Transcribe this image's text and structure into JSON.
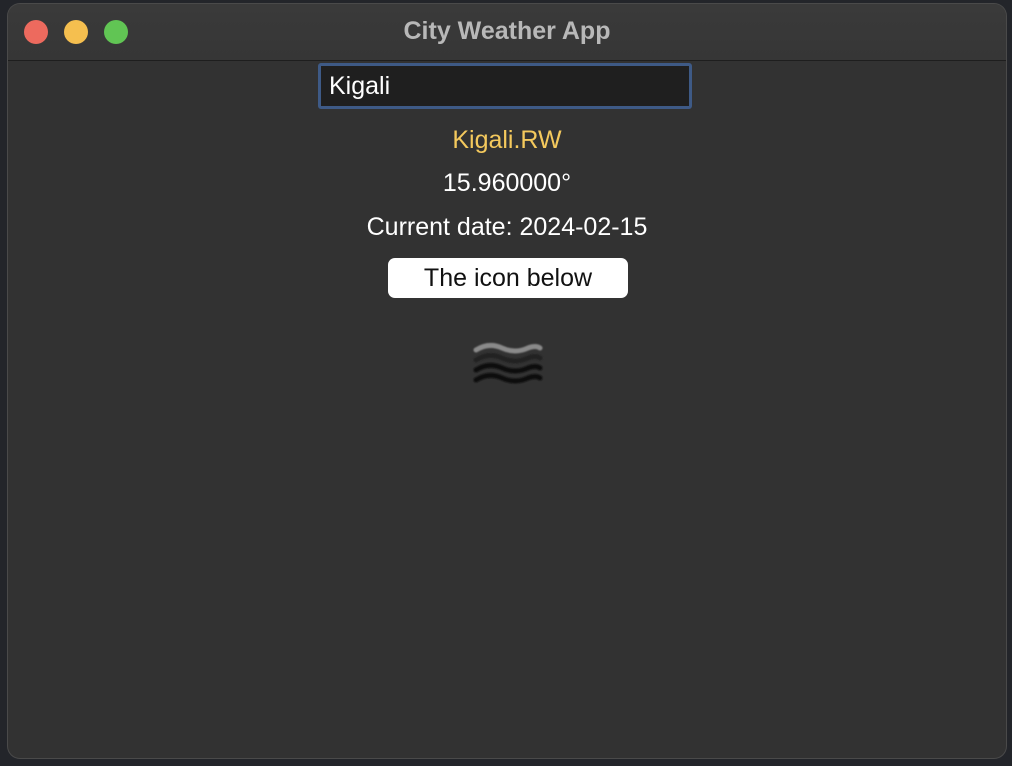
{
  "window": {
    "title": "City Weather App"
  },
  "search": {
    "value": "Kigali"
  },
  "weather": {
    "city": "Kigali.RW",
    "temperature": "15.960000°",
    "date_text": "Current date: 2024-02-15",
    "icon_button_label": "The icon below",
    "icon": "mist-icon"
  },
  "colors": {
    "city_label": "#f4c95d",
    "window_bg": "#323232",
    "input_border": "#3e5a86"
  }
}
